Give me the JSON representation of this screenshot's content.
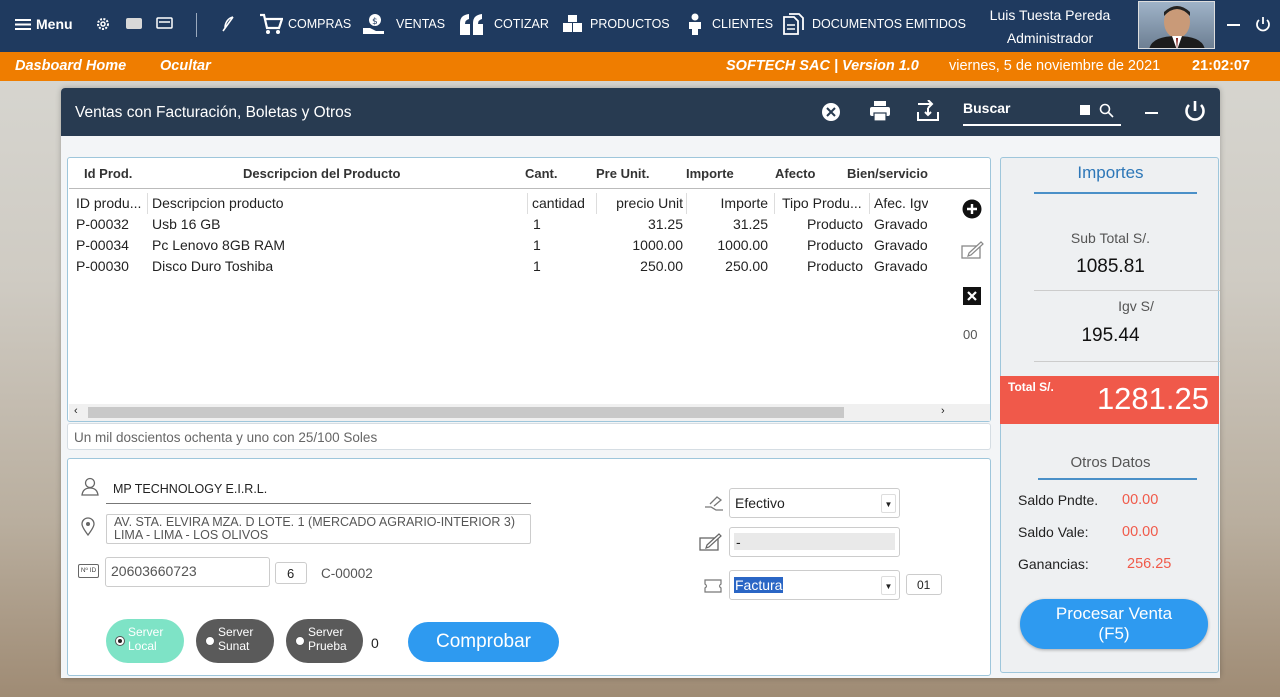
{
  "nav": {
    "menu_label": "Menu",
    "items": [
      {
        "label": "COMPRAS",
        "icon": "cart-icon"
      },
      {
        "label": "VENTAS",
        "icon": "money-hand-icon"
      },
      {
        "label": "COTIZAR",
        "icon": "quote-icon"
      },
      {
        "label": "PRODUCTOS",
        "icon": "boxes-icon"
      },
      {
        "label": "CLIENTES",
        "icon": "people-icon"
      },
      {
        "label": "DOCUMENTOS EMITIDOS",
        "icon": "documents-icon"
      }
    ],
    "user_name": "Luis Tuesta Pereda",
    "user_role": "Administrador",
    "colors": {
      "nav_bg": "#1f3a5f",
      "accent": "#ef7d00"
    }
  },
  "orange_bar": {
    "home": "Dasboard Home",
    "hide": "Ocultar",
    "company": "SOFTECH SAC | Version 1.0",
    "date": "viernes, 5 de noviembre de 2021",
    "time": "21:02:07"
  },
  "window": {
    "title": "Ventas con Facturación, Boletas y Otros",
    "search_label": "Buscar"
  },
  "table": {
    "top_headers": [
      "Id Prod.",
      "Descripcion del Producto",
      "Cant.",
      "Pre Unit.",
      "Importe",
      "Afecto",
      "Bien/servicio"
    ],
    "columns": [
      "ID produ...",
      "Descripcion producto",
      "cantidad",
      "precio Unit",
      "Importe",
      "Tipo Produ...",
      "Afec. Igv"
    ],
    "rows": [
      {
        "id": "P-00032",
        "desc": "Usb 16 GB",
        "qty": "1",
        "price": "31.25",
        "amount": "31.25",
        "type": "Producto",
        "igv": "Gravado"
      },
      {
        "id": "P-00034",
        "desc": "Pc Lenovo 8GB RAM",
        "qty": "1",
        "price": "1000.00",
        "amount": "1000.00",
        "type": "Producto",
        "igv": "Gravado"
      },
      {
        "id": "P-00030",
        "desc": "Disco Duro Toshiba",
        "qty": "1",
        "price": "250.00",
        "amount": "250.00",
        "type": "Producto",
        "igv": "Gravado"
      }
    ],
    "counter": "00"
  },
  "amount_words": "Un mil doscientos ochenta y uno con 25/100 Soles",
  "client": {
    "name": "MP TECHNOLOGY E.I.R.L.",
    "address": "AV. STA. ELVIRA MZA. D LOTE. 1 (MERCADO AGRARIO-INTERIOR 3) LIMA - LIMA - LOS OLIVOS",
    "id_badge": "Nº ID",
    "ruc": "20603660723",
    "doc_type": "6",
    "code": "C-00002"
  },
  "payment": {
    "method": "Efectivo",
    "note": "-",
    "voucher": "Factura",
    "voucher_code": "01"
  },
  "servers": [
    {
      "label": "Server Local",
      "color": "#7ee3c6"
    },
    {
      "label": "Server Sunat",
      "color": "#5a5a5a"
    },
    {
      "label": "Server Prueba",
      "color": "#5a5a5a"
    }
  ],
  "server_count": "0",
  "check_button": "Comprobar",
  "importes": {
    "title": "Importes",
    "subtotal_label": "Sub Total S/.",
    "subtotal": "1085.81",
    "igv_label": "Igv S/",
    "igv": "195.44",
    "total_label": "Total S/.",
    "total": "1281.25",
    "total_color": "#f0594a"
  },
  "otros": {
    "title": "Otros Datos",
    "saldo_pndte_label": "Saldo Pndte.",
    "saldo_pndte": "00.00",
    "saldo_vale_label": "Saldo Vale:",
    "saldo_vale": "00.00",
    "ganancias_label": "Ganancias:",
    "ganancias": "256.25"
  },
  "process_button": "Procesar Venta (F5)"
}
